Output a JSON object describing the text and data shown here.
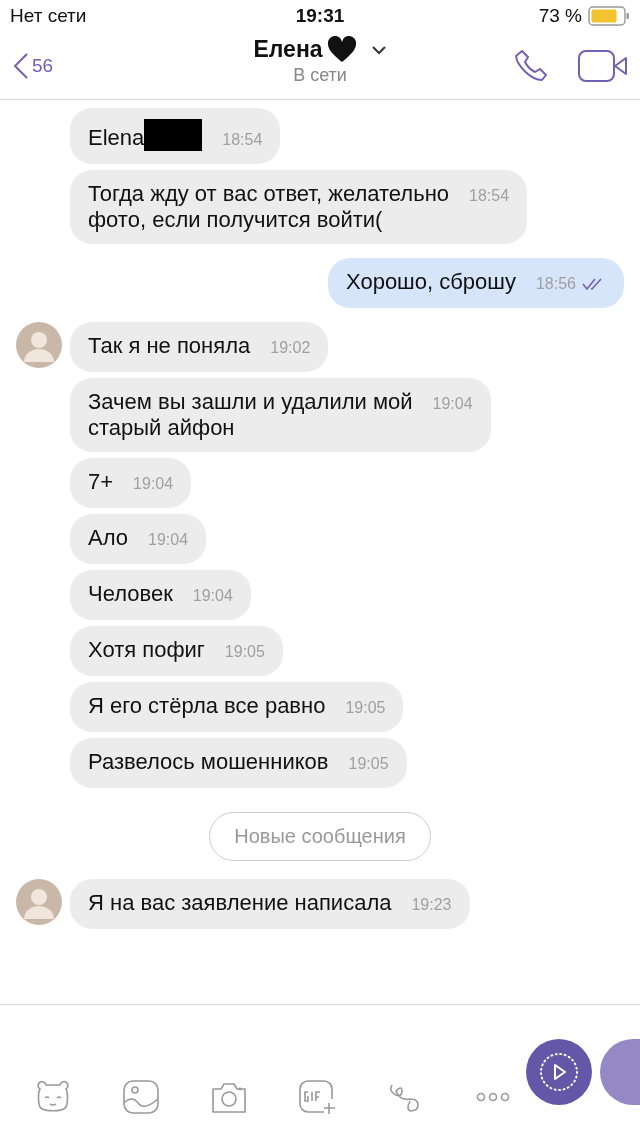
{
  "status_bar": {
    "carrier": "Нет сети",
    "time": "19:31",
    "battery": "73 %"
  },
  "header": {
    "back_count": "56",
    "title": "Елена",
    "status": "В сети"
  },
  "messages": [
    {
      "kind": "incoming",
      "avatar": false,
      "redacted": true,
      "text": "Elena",
      "time": "18:54"
    },
    {
      "kind": "incoming",
      "avatar": false,
      "text": "Тогда жду от вас ответ, желательно\nфото, если получится войти(",
      "time": "18:54"
    },
    {
      "kind": "outgoing",
      "read": true,
      "text": "Хорошо, сброшу",
      "time": "18:56"
    },
    {
      "kind": "incoming",
      "avatar": true,
      "text": "Так я не поняла",
      "time": "19:02"
    },
    {
      "kind": "incoming",
      "avatar": false,
      "text": "Зачем вы зашли и удалили мой\nстарый айфон",
      "time": "19:04"
    },
    {
      "kind": "incoming",
      "avatar": false,
      "text": "7+",
      "time": "19:04"
    },
    {
      "kind": "incoming",
      "avatar": false,
      "text": "Ало",
      "time": "19:04"
    },
    {
      "kind": "incoming",
      "avatar": false,
      "text": "Человек",
      "time": "19:04"
    },
    {
      "kind": "incoming",
      "avatar": false,
      "text": "Хотя пофиг",
      "time": "19:05"
    },
    {
      "kind": "incoming",
      "avatar": false,
      "text": "Я его стёрла все равно",
      "time": "19:05"
    },
    {
      "kind": "incoming",
      "avatar": false,
      "text": "Развелось мошенников",
      "time": "19:05"
    },
    {
      "kind": "divider",
      "text": "Новые сообщения"
    },
    {
      "kind": "incoming",
      "avatar": true,
      "text": "Я на вас заявление написала",
      "time": "19:23"
    }
  ]
}
